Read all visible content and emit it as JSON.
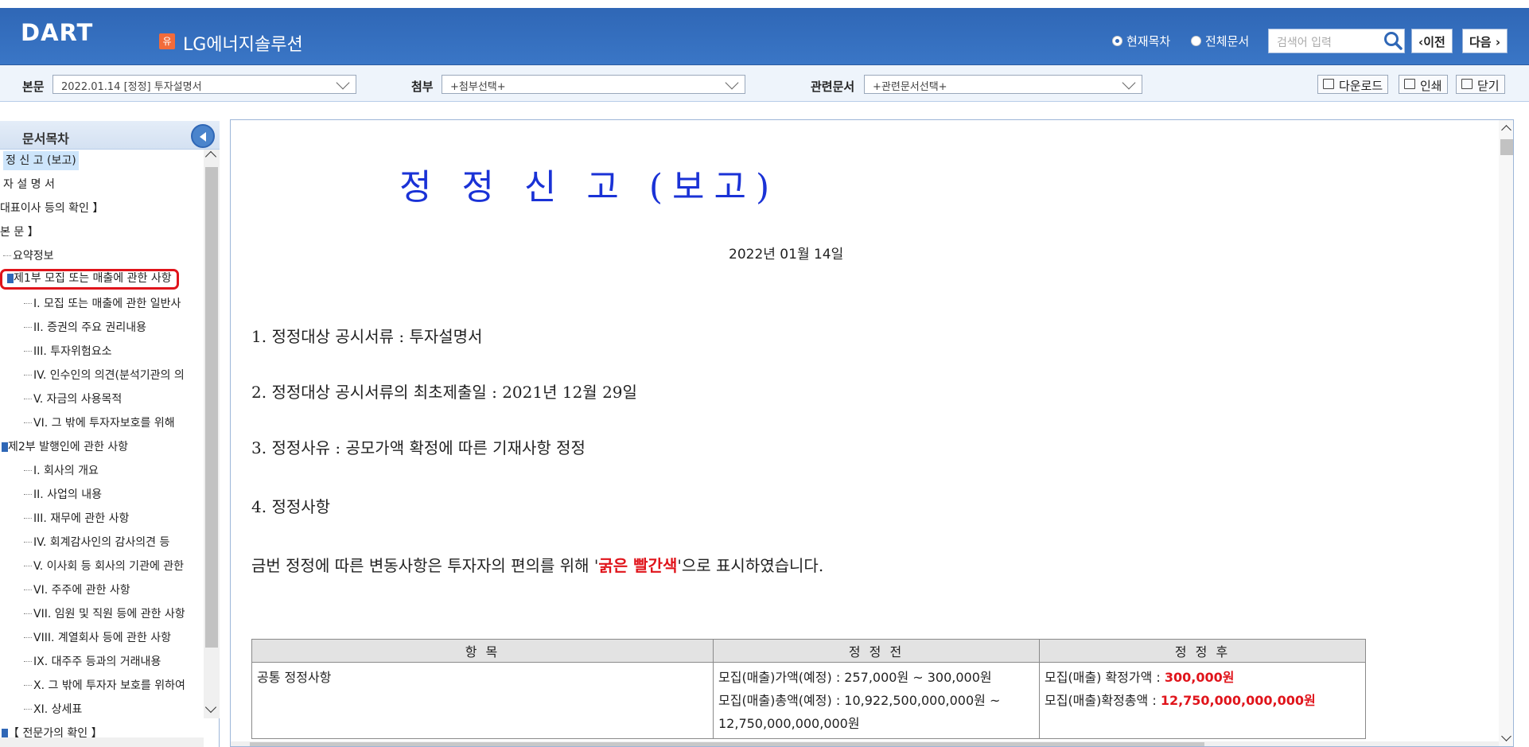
{
  "header": {
    "logo": "DART",
    "company_badge": "유",
    "company": "LG에너지솔루션",
    "radio_current": "현재목차",
    "radio_all": "전체문서",
    "search_placeholder": "검색어 입력",
    "prev_label": "이전",
    "next_label": "다음"
  },
  "toolbar": {
    "main_label": "본문",
    "main_value": "2022.01.14 [정정] 투자설명서",
    "attach_label": "첨부",
    "attach_value": "+첨부선택+",
    "related_label": "관련문서",
    "related_value": "+관련문서선택+",
    "download_label": "다운로드",
    "print_label": "인쇄",
    "close_label": "닫기"
  },
  "sidebar": {
    "title": "문서목차",
    "items": [
      "정 신 고 (보고)",
      "자 설 명 서",
      "대표이사 등의 확인 】",
      "본 문 】",
      "요약정보",
      "제1부 모집 또는 매출에 관한 사항",
      "I. 모집 또는 매출에 관한 일반사",
      "II. 증권의 주요 권리내용",
      "III. 투자위험요소",
      "IV. 인수인의 의견(분석기관의 의",
      "V. 자금의 사용목적",
      "VI. 그 밖에 투자자보호를 위해",
      "제2부 발행인에 관한 사항",
      "I. 회사의 개요",
      "II. 사업의 내용",
      "III. 재무에 관한 사항",
      "IV. 회계감사인의 감사의견 등",
      "V. 이사회 등 회사의 기관에 관한",
      "VI. 주주에 관한 사항",
      "VII. 임원 및 직원 등에 관한 사항",
      "VIII. 계열회사 등에 관한 사항",
      "IX. 대주주 등과의 거래내용",
      "X. 그 밖에 투자자 보호를 위하여",
      "XI. 상세표",
      "【 전문가의 확인 】"
    ]
  },
  "document": {
    "title": "정 정 신 고 (보고)",
    "date": "2022년 01월 14일",
    "item1": "1. 정정대상 공시서류 : 투자설명서",
    "item2": "2. 정정대상 공시서류의 최초제출일 : 2021년 12월 29일",
    "item3": "3. 정정사유 : 공모가액 확정에 따른 기재사항 정정",
    "item4": "4. 정정사항",
    "notice_pre": "금번 정정에 따른 변동사항은 투자자의 편의를 위해 '",
    "notice_red": "굵은 빨간색",
    "notice_post": "'으로 표시하였습니다.",
    "table": {
      "headers": [
        "항 목",
        "정 정 전",
        "정 정 후"
      ],
      "row_item": "공통 정정사항",
      "before_line1": "모집(매출)가액(예정) : 257,000원 ~ 300,000원",
      "before_line2": "모집(매출)총액(예정) : 10,922,500,000,000원 ~ 12,750,000,000,000원",
      "after_line1_label": "모집(매출) 확정가액 : ",
      "after_line1_value": "300,000원",
      "after_line2_label": "모집(매출)확정총액 : ",
      "after_line2_value": "12,750,000,000,000원"
    }
  },
  "colors": {
    "header_blue": "#3a76c6",
    "title_blue": "#1a32d6",
    "highlight_red": "#e0141b",
    "badge_orange": "#f26b3a"
  }
}
